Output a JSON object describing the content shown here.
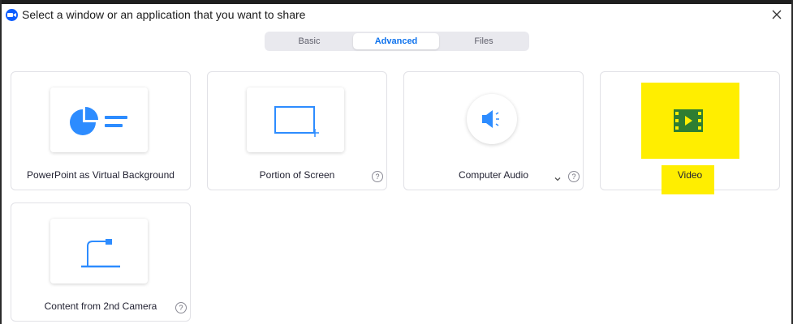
{
  "window": {
    "title": "Select a window or an application that you want to share",
    "logo_icon": "zoom-logo-icon",
    "close_icon": "close-icon"
  },
  "tabs": [
    {
      "label": "Basic",
      "active": false
    },
    {
      "label": "Advanced",
      "active": true
    },
    {
      "label": "Files",
      "active": false
    }
  ],
  "options": [
    {
      "label": "PowerPoint as Virtual Background",
      "icon": "pie-chart-icon",
      "help": false
    },
    {
      "label": "Portion of Screen",
      "icon": "screen-portion-icon",
      "help": true,
      "help_glyph": "?"
    },
    {
      "label": "Computer Audio",
      "icon": "speaker-icon",
      "help": true,
      "help_glyph": "?",
      "dropdown": true
    },
    {
      "label": "Video",
      "icon": "film-play-icon",
      "help": false,
      "highlighted": true
    },
    {
      "label": "Content from 2nd Camera",
      "icon": "document-camera-icon",
      "help": true,
      "help_glyph": "?"
    }
  ],
  "colors": {
    "accent": "#0e72ed",
    "icon_blue": "#2d8cff",
    "highlight": "#ffee00",
    "video_icon": "#2e7d32"
  }
}
